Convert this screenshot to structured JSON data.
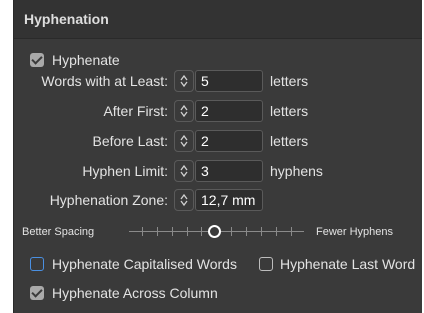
{
  "panel": {
    "title": "Hyphenation",
    "hyphenate": {
      "label": "Hyphenate",
      "checked": true
    },
    "fields": [
      {
        "label": "Words with at Least:",
        "value": "5",
        "unit": "letters"
      },
      {
        "label": "After First:",
        "value": "2",
        "unit": "letters"
      },
      {
        "label": "Before Last:",
        "value": "2",
        "unit": "letters"
      },
      {
        "label": "Hyphen Limit:",
        "value": "3",
        "unit": "hyphens"
      },
      {
        "label": "Hyphenation Zone:",
        "value": "12,7 mm",
        "unit": ""
      }
    ],
    "slider": {
      "left_label": "Better Spacing",
      "right_label": "Fewer Hyphens",
      "value_fraction": 0.5
    },
    "options": [
      {
        "label": "Hyphenate Capitalised Words",
        "checked": false
      },
      {
        "label": "Hyphenate Last Word",
        "checked": false
      },
      {
        "label": "Hyphenate Across Column",
        "checked": true
      }
    ]
  },
  "colors": {
    "panel_bg": "#3a3a3a",
    "header_bg": "#333333",
    "accent_blue": "#4a90e2"
  }
}
